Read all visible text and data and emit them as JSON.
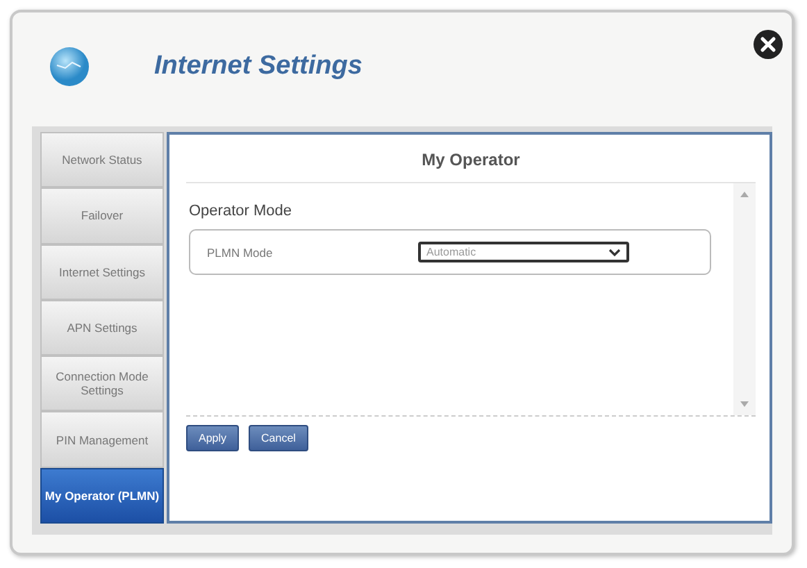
{
  "window": {
    "title": "Internet Settings"
  },
  "sidebar": {
    "items": [
      {
        "label": "Network Status",
        "selected": false
      },
      {
        "label": "Failover",
        "selected": false
      },
      {
        "label": "Internet Settings",
        "selected": false
      },
      {
        "label": "APN Settings",
        "selected": false
      },
      {
        "label": "Connection Mode Settings",
        "selected": false
      },
      {
        "label": "PIN Management",
        "selected": false
      },
      {
        "label": "My Operator (PLMN)",
        "selected": true
      }
    ]
  },
  "panel": {
    "title": "My Operator",
    "section": "Operator Mode",
    "fields": [
      {
        "label": "PLMN Mode",
        "value": "Automatic"
      }
    ],
    "buttons": [
      "Apply",
      "Cancel"
    ]
  }
}
